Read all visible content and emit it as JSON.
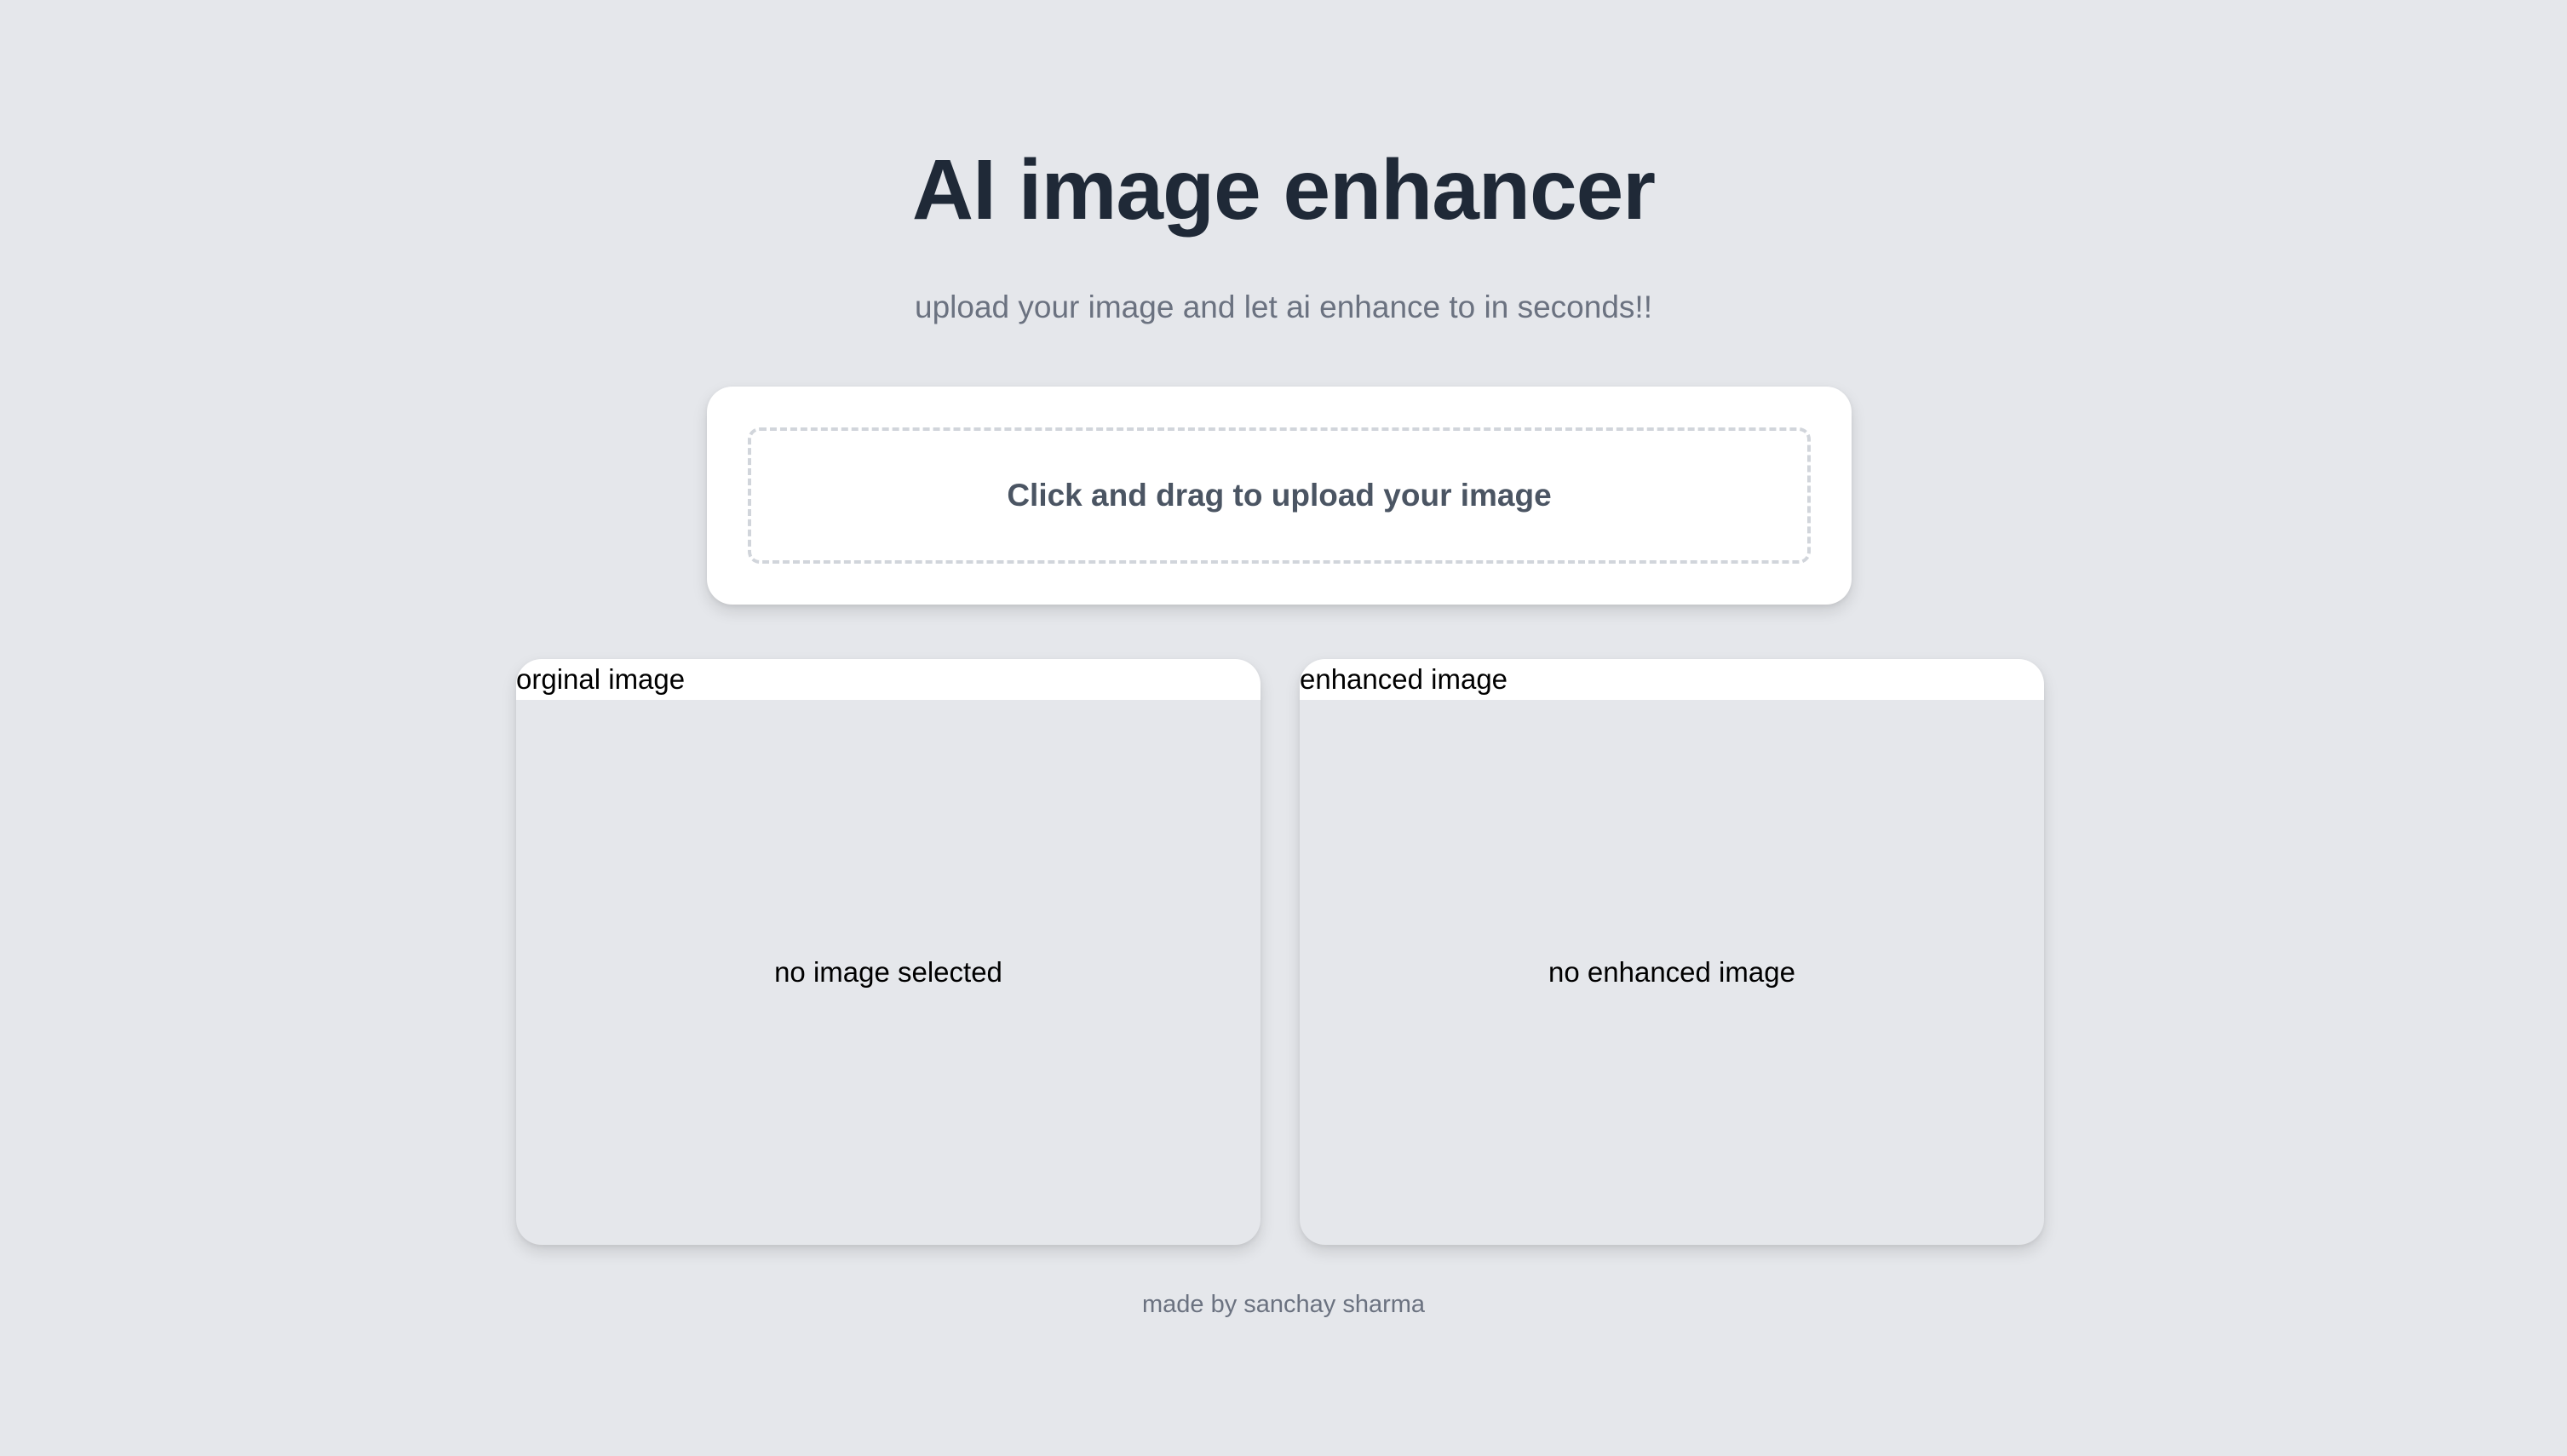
{
  "header": {
    "title": "AI image enhancer",
    "subtitle": "upload your image and let ai enhance to in seconds!!"
  },
  "upload": {
    "label": "Click and drag to upload your image"
  },
  "panels": {
    "original": {
      "title": "orginal image",
      "empty_text": "no image selected"
    },
    "enhanced": {
      "title": "enhanced image",
      "empty_text": "no enhanced image"
    }
  },
  "footer": {
    "credit": "made by sanchay sharma"
  },
  "colors": {
    "background": "#e5e7eb",
    "title": "#1f2937",
    "muted_text": "#6b7280",
    "card": "#ffffff"
  }
}
